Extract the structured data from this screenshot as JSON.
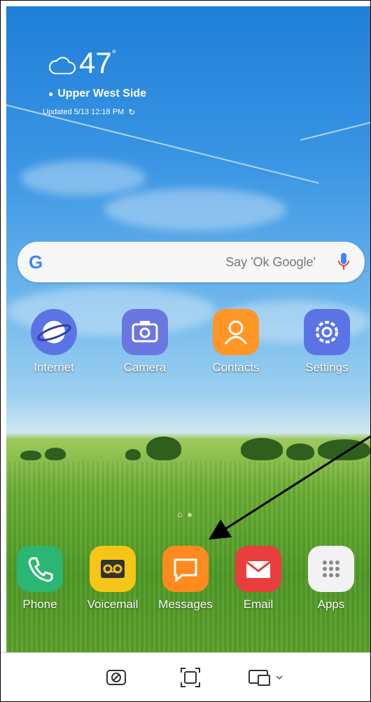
{
  "weather": {
    "temperature": "47",
    "degree_symbol": "°",
    "location": "Upper West Side",
    "updated": "Updated 5/13 12:18 PM"
  },
  "search_bar": {
    "logo": "G",
    "hint": "Say 'Ok Google'",
    "icons": [
      "google-logo",
      "mic-icon"
    ]
  },
  "home_apps": [
    {
      "label": "Internet",
      "icon": "internet-icon",
      "color": "#5a74e6"
    },
    {
      "label": "Camera",
      "icon": "camera-icon",
      "color": "#6c76e0"
    },
    {
      "label": "Contacts",
      "icon": "contacts-icon",
      "color": "#ff9626"
    },
    {
      "label": "Settings",
      "icon": "gear-icon",
      "color": "#5a74e6"
    }
  ],
  "dock_apps": [
    {
      "label": "Phone",
      "icon": "phone-icon",
      "color": "#2bb673"
    },
    {
      "label": "Voicemail",
      "icon": "voicemail-icon",
      "color": "#f5c518"
    },
    {
      "label": "Messages",
      "icon": "messages-icon",
      "color": "#ff8a1f"
    },
    {
      "label": "Email",
      "icon": "mail-icon",
      "color": "#e83e3e"
    },
    {
      "label": "Apps",
      "icon": "apps-grid-icon",
      "color": "#f2f2f2"
    }
  ],
  "page_indicator": {
    "current": 1,
    "total": 2
  },
  "toolbar_icons": [
    "screenshot-icon",
    "capture-region-icon",
    "devices-dropdown-icon"
  ]
}
